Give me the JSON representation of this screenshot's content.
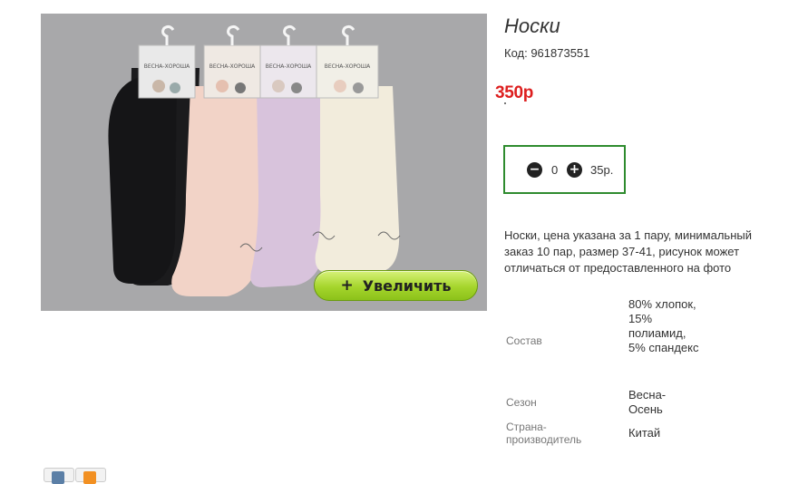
{
  "product": {
    "title": "Носки",
    "code": "Код: 961873551",
    "price": "350р",
    "description": "Носки, цена указана за 1 пару, минимальный заказ 10 пар, размер 37-41, рисунок может отличаться от предоставленного на фото"
  },
  "photo": {
    "brand_label": "ВЕСНА-ХОРОША",
    "sock_colors": [
      "#1b1b1d",
      "#f2d3c7",
      "#d8c3dc",
      "#f2ecdc"
    ],
    "zoom_button": {
      "plus": "+",
      "label": "Увеличить"
    }
  },
  "quantity": {
    "minus_icon": "−",
    "plus_icon": "+",
    "value": "0",
    "total": "35р."
  },
  "specs": [
    {
      "label": "Состав",
      "value": "80% хлопок, 15% полиамид, 5% спандекс"
    },
    {
      "label": "Сезон",
      "value": "Весна-Осень"
    },
    {
      "label": "Страна-производитель",
      "value": "Китай"
    }
  ],
  "colors": {
    "price": "#dd1f1f",
    "qty_border": "#2e8b2e",
    "zoom_button": "#a5d52c"
  },
  "share_icons": [
    "vk-icon",
    "odnoklassniki-icon"
  ]
}
